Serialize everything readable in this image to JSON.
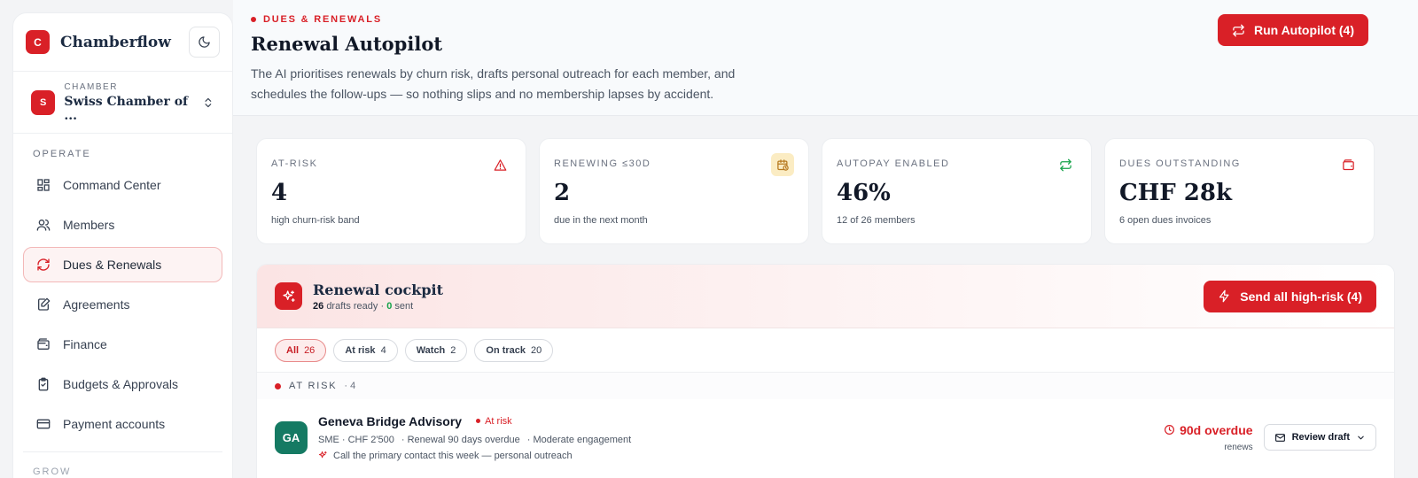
{
  "brand": {
    "logo_letter": "C",
    "name": "Chamberflow"
  },
  "chamber": {
    "logo_letter": "S",
    "kicker": "CHAMBER",
    "name": "Swiss Chamber of ..."
  },
  "nav": {
    "section_operate": "OPERATE",
    "items": [
      {
        "label": "Command Center",
        "icon": "grid-icon"
      },
      {
        "label": "Members",
        "icon": "users-icon"
      },
      {
        "label": "Dues & Renewals",
        "icon": "refresh-icon",
        "active": true
      },
      {
        "label": "Agreements",
        "icon": "document-edit-icon"
      },
      {
        "label": "Finance",
        "icon": "wallet-icon"
      },
      {
        "label": "Budgets & Approvals",
        "icon": "clipboard-check-icon"
      },
      {
        "label": "Payment accounts",
        "icon": "credit-card-icon"
      }
    ],
    "section_grow": "GROW"
  },
  "header": {
    "kicker": "DUES & RENEWALS",
    "title": "Renewal Autopilot",
    "description": "The AI prioritises renewals by churn risk, drafts personal outreach for each member, and schedules the follow-ups — so nothing slips and no membership lapses by accident.",
    "primary_button": "Run Autopilot (4)"
  },
  "stats": [
    {
      "label": "AT-RISK",
      "value": "4",
      "sub": "high churn-risk band",
      "icon": "alert-triangle-icon"
    },
    {
      "label": "RENEWING ≤30D",
      "value": "2",
      "sub": "due in the next month",
      "icon": "calendar-clock-icon"
    },
    {
      "label": "AUTOPAY ENABLED",
      "value": "46%",
      "sub": "12 of 26 members",
      "icon": "repeat-icon"
    },
    {
      "label": "DUES OUTSTANDING",
      "value": "CHF 28k",
      "sub": "6 open dues invoices",
      "icon": "wallet-icon"
    }
  ],
  "cockpit": {
    "title": "Renewal cockpit",
    "drafts_count": "26",
    "drafts_label": "drafts ready ·",
    "sent_count": "0",
    "sent_label": "sent",
    "send_button": "Send all high-risk (4)",
    "filters": [
      {
        "label": "All",
        "count": "26",
        "active": true
      },
      {
        "label": "At risk",
        "count": "4"
      },
      {
        "label": "Watch",
        "count": "2"
      },
      {
        "label": "On track",
        "count": "20"
      }
    ],
    "group": {
      "label": "AT RISK",
      "count": "· 4"
    },
    "rows": [
      {
        "initials": "GA",
        "name": "Geneva Bridge Advisory",
        "badge": "At risk",
        "meta": [
          "SME · CHF 2'500",
          "· Renewal 90 days overdue",
          "· Moderate engagement"
        ],
        "hint": "Call the primary contact this week — personal outreach",
        "status": "90d overdue",
        "status_sub": "renews",
        "action": "Review draft"
      }
    ]
  },
  "colors": {
    "accent": "#d92027",
    "avatar_green": "#157a63",
    "navy": "#1b2a41"
  }
}
